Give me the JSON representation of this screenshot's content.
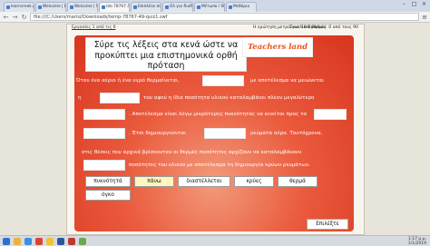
{
  "browser": {
    "tabs": [
      {
        "label": "learncreek.gr"
      },
      {
        "label": "Welcome | Eddewith"
      },
      {
        "label": "Welcome | Welcome"
      },
      {
        "label": "ίσο 78767 40 φυσ",
        "active": true
      },
      {
        "label": "Επιπλέον σύγχρον"
      },
      {
        "label": "Ολ για διαδικασίες"
      },
      {
        "label": "Μέτωπο / Θερμών"
      },
      {
        "label": "Μεθόριο"
      }
    ],
    "url": "file:///C:/Users/marisi/Downloads/temp-78767-49-quiz1.swf"
  },
  "quiz": {
    "tab_label": "Εργασίες 1 από τις 6",
    "question_count": "Η ερώτηση μετρά για: 10 Βαθμούς",
    "score": "Συνολικοί βαθμοί: 0 από τους 90",
    "logo_text": "Teachers land",
    "instruction": "Σύρε τις λέξεις στα κενά ώστε να προκύπτει μια επιστημονικά ορθή πρόταση",
    "lines": [
      {
        "a": "Όταν ένα αέριο ή ένα υγρό θερμαίνεται,",
        "b": "με αποτέλεσμα να μειώνεται"
      },
      {
        "a": "η",
        "b": "του αφού η ίδια ποσότητα υλικού καταλαμβάνει πλέον μεγαλύτερο"
      },
      {
        "a": "",
        "b": ". Αποτέλεσμα είναι λόγω μικρότερης πυκνότητας να κινείται προς τα"
      },
      {
        "a": "",
        "b": ". Έτσι δημιουργούνται",
        "c": "ρεύματα αέρα. Ταυτόχρονα,"
      },
      {
        "a": "στις θέσεις που αρχικά βρίσκονταν οι θερμές ποσότητες αρχίζουν να καταλαμβάνουν"
      },
      {
        "a": "",
        "b": "ποσότητες του υλικού με αποτέλεσμα τη δημιουργία κρύων ρευμάτων."
      }
    ],
    "words": [
      "πυκνότητά",
      "πάνω",
      "διαστέλλεται",
      "κρύες",
      "θερμά",
      "όγκο"
    ],
    "check_label": "Επιλέξτε"
  },
  "colors": {
    "panel": "#e0452b",
    "selected_word": "#fff6c0",
    "logo": "#e8521f"
  },
  "taskbar": {
    "clock": "1:17 μ.μ.",
    "date": "1/1/2019"
  }
}
